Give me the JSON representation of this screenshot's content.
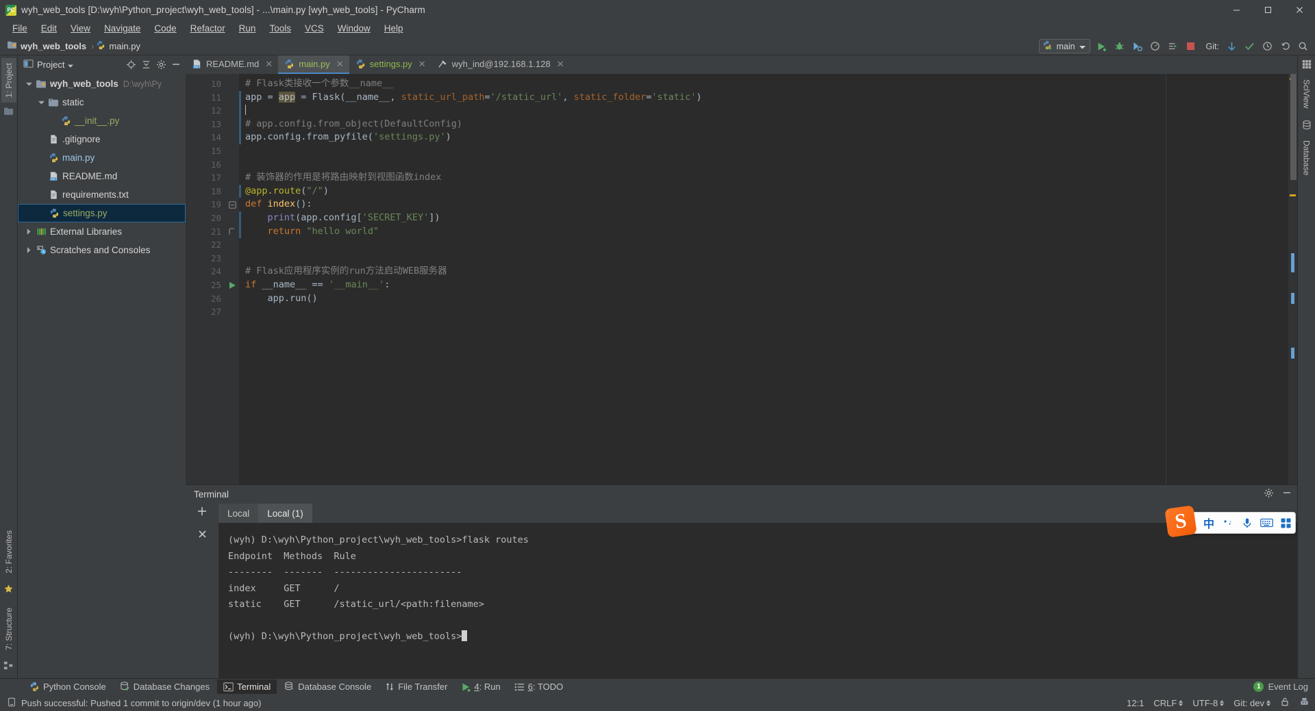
{
  "window": {
    "title": "wyh_web_tools [D:\\wyh\\Python_project\\wyh_web_tools] - ...\\main.py [wyh_web_tools] - PyCharm",
    "minimize_label": "Minimize",
    "maximize_label": "Maximize",
    "close_label": "Close"
  },
  "menubar": {
    "items": [
      "File",
      "Edit",
      "View",
      "Navigate",
      "Code",
      "Refactor",
      "Run",
      "Tools",
      "VCS",
      "Window",
      "Help"
    ]
  },
  "navbar": {
    "breadcrumb": [
      "wyh_web_tools",
      "main.py"
    ],
    "run_config": "main",
    "git_label": "Git:",
    "icons": [
      "run-icon",
      "debug-icon",
      "coverage-icon",
      "profile-icon",
      "attach-icon",
      "stop-icon",
      "git-update-icon",
      "git-commit-icon",
      "history-icon",
      "undo-icon",
      "search-everywhere-icon"
    ]
  },
  "left_strip": {
    "project_tab": "1: Project",
    "favorites_tab": "2: Favorites",
    "structure_tab": "7: Structure"
  },
  "right_strip": {
    "sciview_tab": "SciView",
    "database_tab": "Database"
  },
  "project_panel": {
    "header_title": "Project",
    "toolbar_icons": [
      "locate-icon",
      "collapse-all-icon",
      "gear-icon",
      "hide-icon"
    ],
    "tree": [
      {
        "label": "wyh_web_tools",
        "sub": "D:\\wyh\\Py",
        "arrow": "down",
        "icon": "folder-module-icon",
        "indent": 0,
        "style": "bold",
        "selected": false
      },
      {
        "label": "static",
        "sub": "",
        "arrow": "down",
        "icon": "folder-source-icon",
        "indent": 1,
        "style": "plain",
        "selected": false
      },
      {
        "label": "__init__.py",
        "sub": "",
        "arrow": "none",
        "icon": "python-file-icon",
        "indent": 2,
        "style": "green",
        "selected": false
      },
      {
        "label": ".gitignore",
        "sub": "",
        "arrow": "none",
        "icon": "text-file-icon",
        "indent": 1,
        "style": "plain",
        "selected": false
      },
      {
        "label": "main.py",
        "sub": "",
        "arrow": "none",
        "icon": "python-file-icon",
        "indent": 1,
        "style": "py",
        "selected": false
      },
      {
        "label": "README.md",
        "sub": "",
        "arrow": "none",
        "icon": "markdown-file-icon",
        "indent": 1,
        "style": "plain",
        "selected": false
      },
      {
        "label": "requirements.txt",
        "sub": "",
        "arrow": "none",
        "icon": "text-file-icon",
        "indent": 1,
        "style": "plain",
        "selected": false
      },
      {
        "label": "settings.py",
        "sub": "",
        "arrow": "none",
        "icon": "python-file-icon",
        "indent": 1,
        "style": "green",
        "selected": true
      },
      {
        "label": "External Libraries",
        "sub": "",
        "arrow": "right",
        "icon": "libraries-icon",
        "indent": 0,
        "style": "plain",
        "selected": false
      },
      {
        "label": "Scratches and Consoles",
        "sub": "",
        "arrow": "right",
        "icon": "scratches-icon",
        "indent": 0,
        "style": "plain",
        "selected": false
      }
    ]
  },
  "editor": {
    "tabs": [
      {
        "label": "README.md",
        "icon": "markdown-file-icon",
        "active": false,
        "color": "plain"
      },
      {
        "label": "main.py",
        "icon": "python-file-icon",
        "active": true,
        "color": "green"
      },
      {
        "label": "settings.py",
        "icon": "python-file-icon",
        "active": false,
        "color": "green"
      },
      {
        "label": "wyh_ind@192.168.1.128",
        "icon": "remote-host-icon",
        "active": false,
        "color": "plain"
      }
    ],
    "first_line_number": 10,
    "lines": [
      {
        "n": 10,
        "segments": [
          {
            "t": "# Flask类接收一个参数__name__",
            "c": "cmt"
          }
        ],
        "changed": false,
        "fold": "",
        "gutter_mark": ""
      },
      {
        "n": 11,
        "segments": [
          {
            "t": "app ",
            "c": "def"
          },
          {
            "t": "= ",
            "c": "def"
          },
          {
            "t": "app",
            "c": "highlight"
          },
          {
            "t": " = Flask(__name__, ",
            "c": "def"
          },
          {
            "t": "static_url_path",
            "c": "param"
          },
          {
            "t": "=",
            "c": "def"
          },
          {
            "t": "'/static_url'",
            "c": "str"
          },
          {
            "t": ", ",
            "c": "def"
          },
          {
            "t": "static_folder",
            "c": "param"
          },
          {
            "t": "=",
            "c": "def"
          },
          {
            "t": "'static'",
            "c": "str"
          },
          {
            "t": ")",
            "c": "def"
          }
        ],
        "changed": true,
        "fold": "",
        "gutter_mark": ""
      },
      {
        "n": 12,
        "segments": [
          {
            "t": "",
            "c": "def"
          }
        ],
        "changed": true,
        "fold": "",
        "gutter_mark": "caret"
      },
      {
        "n": 13,
        "segments": [
          {
            "t": "# app.config.from_object(DefaultConfig)",
            "c": "cmt"
          }
        ],
        "changed": true,
        "fold": "",
        "gutter_mark": ""
      },
      {
        "n": 14,
        "segments": [
          {
            "t": "app.config.from_pyfile(",
            "c": "def"
          },
          {
            "t": "'settings.py'",
            "c": "str"
          },
          {
            "t": ")",
            "c": "def"
          }
        ],
        "changed": true,
        "fold": "",
        "gutter_mark": ""
      },
      {
        "n": 15,
        "segments": [
          {
            "t": "",
            "c": "def"
          }
        ],
        "changed": false,
        "fold": "",
        "gutter_mark": ""
      },
      {
        "n": 16,
        "segments": [
          {
            "t": "",
            "c": "def"
          }
        ],
        "changed": false,
        "fold": "",
        "gutter_mark": ""
      },
      {
        "n": 17,
        "segments": [
          {
            "t": "# 装饰器的作用是将路由映射到视图函数index",
            "c": "cmt"
          }
        ],
        "changed": false,
        "fold": "",
        "gutter_mark": ""
      },
      {
        "n": 18,
        "segments": [
          {
            "t": "@app.route",
            "c": "deco"
          },
          {
            "t": "(",
            "c": "def"
          },
          {
            "t": "\"/\"",
            "c": "str"
          },
          {
            "t": ")",
            "c": "def"
          }
        ],
        "changed": true,
        "fold": "",
        "gutter_mark": ""
      },
      {
        "n": 19,
        "segments": [
          {
            "t": "def ",
            "c": "kw"
          },
          {
            "t": "index",
            "c": "fn"
          },
          {
            "t": "():",
            "c": "def"
          }
        ],
        "changed": false,
        "fold": "collapse-top",
        "gutter_mark": ""
      },
      {
        "n": 20,
        "segments": [
          {
            "t": "    ",
            "c": "def"
          },
          {
            "t": "print",
            "c": "builtin"
          },
          {
            "t": "(app.config[",
            "c": "def"
          },
          {
            "t": "'SECRET_KEY'",
            "c": "str"
          },
          {
            "t": "])",
            "c": "def"
          }
        ],
        "changed": true,
        "fold": "",
        "gutter_mark": ""
      },
      {
        "n": 21,
        "segments": [
          {
            "t": "    ",
            "c": "def"
          },
          {
            "t": "return ",
            "c": "kw"
          },
          {
            "t": "\"hello world\"",
            "c": "str"
          }
        ],
        "changed": true,
        "fold": "collapse-bottom",
        "gutter_mark": ""
      },
      {
        "n": 22,
        "segments": [
          {
            "t": "",
            "c": "def"
          }
        ],
        "changed": false,
        "fold": "",
        "gutter_mark": ""
      },
      {
        "n": 23,
        "segments": [
          {
            "t": "",
            "c": "def"
          }
        ],
        "changed": false,
        "fold": "",
        "gutter_mark": ""
      },
      {
        "n": 24,
        "segments": [
          {
            "t": "# Flask应用程序实例的run方法启动WEB服务器",
            "c": "cmt"
          }
        ],
        "changed": false,
        "fold": "",
        "gutter_mark": ""
      },
      {
        "n": 25,
        "segments": [
          {
            "t": "if ",
            "c": "kw"
          },
          {
            "t": "__name__ == ",
            "c": "def"
          },
          {
            "t": "'__main__'",
            "c": "str"
          },
          {
            "t": ":",
            "c": "def"
          }
        ],
        "changed": false,
        "fold": "",
        "gutter_mark": "run"
      },
      {
        "n": 26,
        "segments": [
          {
            "t": "    app.run()",
            "c": "def"
          }
        ],
        "changed": false,
        "fold": "",
        "gutter_mark": ""
      },
      {
        "n": 27,
        "segments": [
          {
            "t": "",
            "c": "def"
          }
        ],
        "changed": false,
        "fold": "",
        "gutter_mark": ""
      }
    ]
  },
  "terminal": {
    "panel_title": "Terminal",
    "add_tab_label": "+",
    "close_tab_label": "×",
    "settings_icon": "gear-icon",
    "hide_icon": "minimize-icon",
    "tabs": [
      {
        "label": "Local",
        "active": false
      },
      {
        "label": "Local (1)",
        "active": true
      }
    ],
    "output_lines": [
      "(wyh) D:\\wyh\\Python_project\\wyh_web_tools>flask routes",
      "Endpoint  Methods  Rule",
      "--------  -------  -----------------------",
      "index     GET      /",
      "static    GET      /static_url/<path:filename>",
      "",
      "(wyh) D:\\wyh\\Python_project\\wyh_web_tools>"
    ],
    "routes_table": {
      "headers": [
        "Endpoint",
        "Methods",
        "Rule"
      ],
      "rows": [
        [
          "index",
          "GET",
          "/"
        ],
        [
          "static",
          "GET",
          "/static_url/<path:filename>"
        ]
      ]
    }
  },
  "bottom_tabs": {
    "items": [
      {
        "label": "Python Console",
        "icon": "python-console-icon",
        "active": false,
        "mnemonic": ""
      },
      {
        "label": "Database Changes",
        "icon": "database-changes-icon",
        "active": false,
        "mnemonic": ""
      },
      {
        "label": "Terminal",
        "icon": "terminal-icon",
        "active": true,
        "mnemonic": ""
      },
      {
        "label": "Database Console",
        "icon": "database-console-icon",
        "active": false,
        "mnemonic": ""
      },
      {
        "label": "File Transfer",
        "icon": "file-transfer-icon",
        "active": false,
        "mnemonic": ""
      },
      {
        "label": "4: Run",
        "icon": "run-icon",
        "active": false,
        "mnemonic": "4"
      },
      {
        "label": "6: TODO",
        "icon": "todo-icon",
        "active": false,
        "mnemonic": "6"
      }
    ],
    "event_log_label": "Event Log",
    "event_log_count": "1"
  },
  "statusbar": {
    "message": "Push successful: Pushed 1 commit to origin/dev (1 hour ago)",
    "message_icon": "notification-icon",
    "caret_position": "12:1",
    "line_separator": "CRLF",
    "encoding": "UTF-8",
    "git_branch": "Git: dev",
    "lock_icon": "unlocked-icon",
    "inspection_icon": "inspector-icon"
  },
  "ime": {
    "name": "sogou-ime",
    "logo_letter": "S",
    "mode_label": "中",
    "items": [
      "language-mode",
      "punctuation-mode",
      "voice-input",
      "soft-keyboard",
      "toolbox"
    ]
  },
  "colors": {
    "accent": "#4a88c7",
    "panel_bg": "#3c3f41",
    "editor_bg": "#2b2b2b",
    "gutter_bg": "#313335",
    "selection_bg": "#0d293e",
    "string_green": "#6a8759",
    "keyword_orange": "#cc7832",
    "comment_gray": "#808080",
    "run_green": "#59a869"
  }
}
